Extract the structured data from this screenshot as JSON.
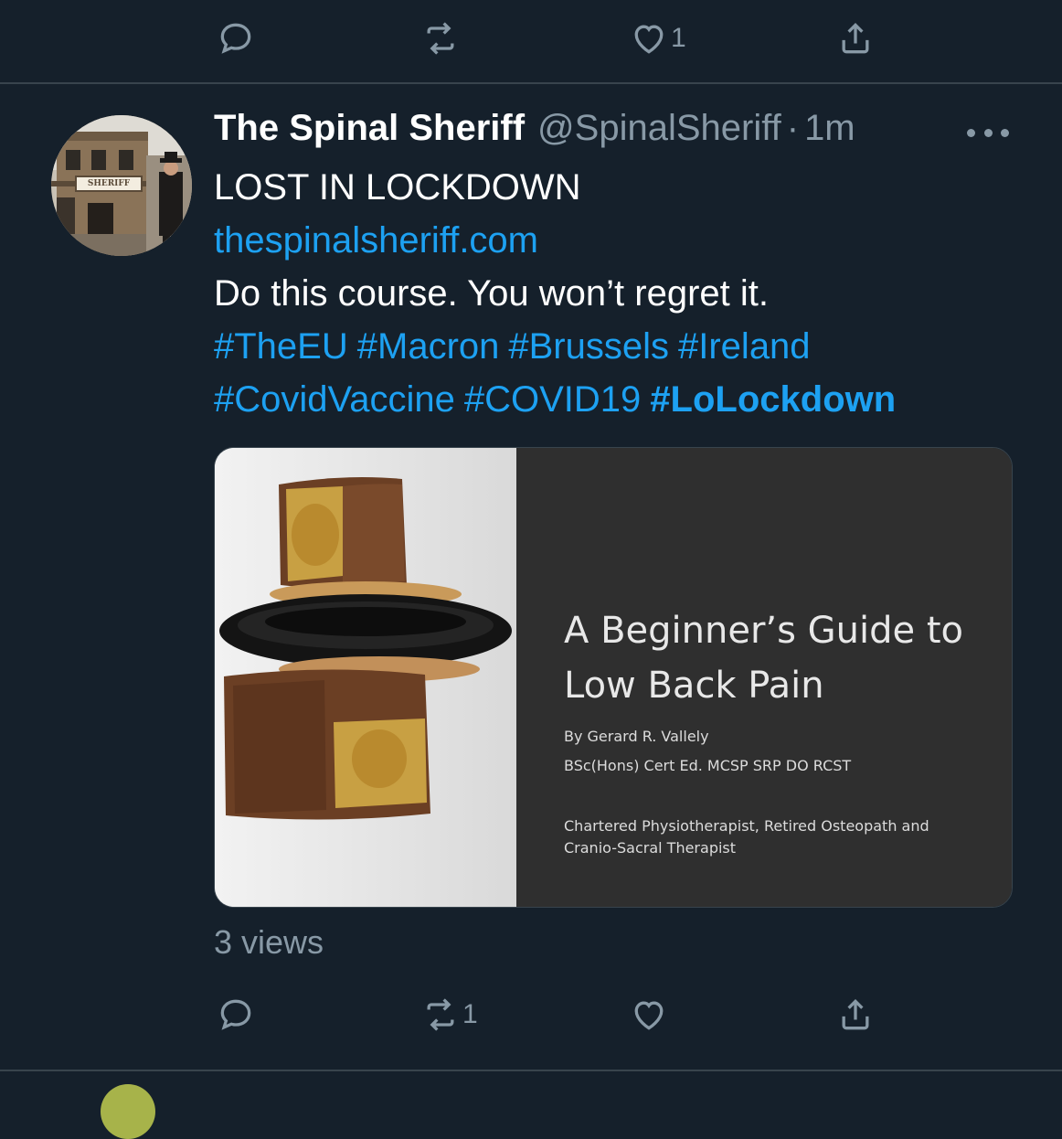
{
  "previous_tweet": {
    "actions": {
      "reply_count": "",
      "retweet_count": "",
      "like_count": "1",
      "share_count": ""
    }
  },
  "tweet": {
    "display_name": "The Spinal Sheriff",
    "handle": "@SpinalSheriff",
    "separator": "·",
    "time": "1m",
    "avatar_sign": "SHERIFF",
    "lines": {
      "title": "LOST IN LOCKDOWN",
      "link": "thespinalsheriff.com",
      "message": "Do this course. You won’t regret it."
    },
    "hashtags_line1": [
      "#TheEU",
      "#Macron",
      "#Brussels",
      "#Ireland"
    ],
    "hashtags_line2": [
      "#CovidVaccine",
      "#COVID19",
      "#LoLockdown"
    ],
    "media": {
      "title": "A Beginner’s Guide to Low Back Pain",
      "author": "By Gerard R. Vallely",
      "qualifications": "BSc(Hons) Cert Ed. MCSP SRP DO RCST",
      "role": "Chartered Physiotherapist, Retired Osteopath and Cranio-Sacral Therapist"
    },
    "views": "3 views",
    "actions": {
      "reply_count": "",
      "retweet_count": "1",
      "like_count": "",
      "share_count": ""
    }
  },
  "colors": {
    "background": "#15202b",
    "accent": "#1da1f2",
    "muted": "#8899a6",
    "divider": "#38444d"
  }
}
